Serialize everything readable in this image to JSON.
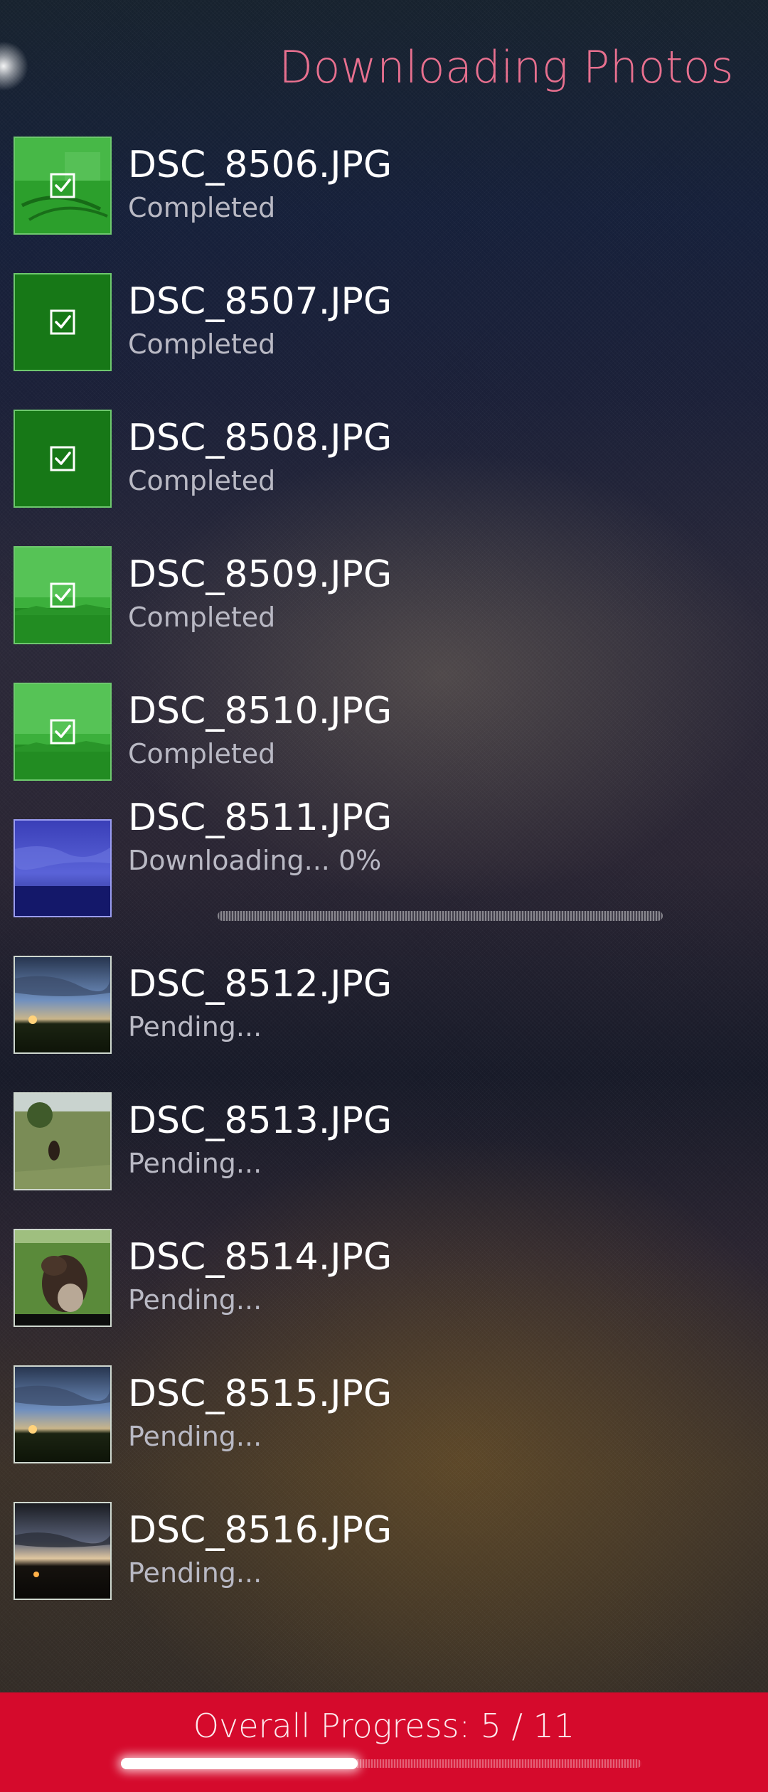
{
  "title": "Downloading Photos",
  "items": [
    {
      "name": "DSC_8506.JPG",
      "status": "Completed",
      "thumb": "green-cable-photo",
      "state": "completed"
    },
    {
      "name": "DSC_8507.JPG",
      "status": "Completed",
      "thumb": "green-solid",
      "state": "completed"
    },
    {
      "name": "DSC_8508.JPG",
      "status": "Completed",
      "thumb": "green-solid",
      "state": "completed"
    },
    {
      "name": "DSC_8509.JPG",
      "status": "Completed",
      "thumb": "green-landscape-photo",
      "state": "completed"
    },
    {
      "name": "DSC_8510.JPG",
      "status": "Completed",
      "thumb": "green-landscape-photo",
      "state": "completed"
    },
    {
      "name": "DSC_8511.JPG",
      "status": "Downloading... 0%",
      "thumb": "blue-dusk-landscape-photo",
      "state": "downloading",
      "progress": 0
    },
    {
      "name": "DSC_8512.JPG",
      "status": "Pending...",
      "thumb": "sunset-field-photo",
      "state": "pending"
    },
    {
      "name": "DSC_8513.JPG",
      "status": "Pending...",
      "thumb": "dog-meadow-photo",
      "state": "pending"
    },
    {
      "name": "DSC_8514.JPG",
      "status": "Pending...",
      "thumb": "dog-closeup-photo",
      "state": "pending"
    },
    {
      "name": "DSC_8515.JPG",
      "status": "Pending...",
      "thumb": "sunset-field-photo",
      "state": "pending"
    },
    {
      "name": "DSC_8516.JPG",
      "status": "Pending...",
      "thumb": "dark-sunset-photo",
      "state": "pending"
    }
  ],
  "overall": {
    "label": "Overall Progress: 5 / 11",
    "completed": 5,
    "total": 11
  },
  "colors": {
    "title": "#e8708f",
    "footer": "#d50a2c",
    "completed_overlay": "#1fa31f"
  },
  "icons": {
    "completed": "checkbox-checked-icon"
  }
}
